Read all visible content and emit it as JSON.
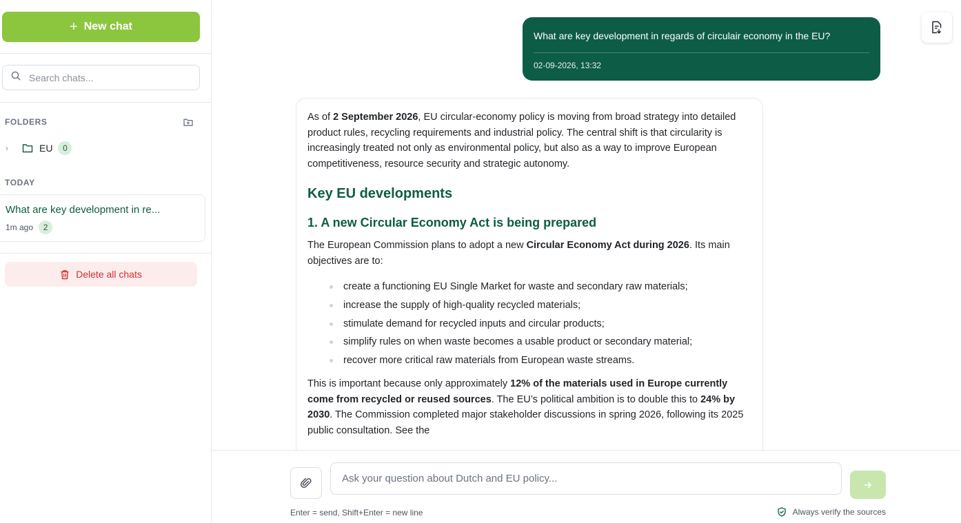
{
  "sidebar": {
    "new_chat_label": "New chat",
    "search_placeholder": "Search chats...",
    "folders_heading": "FOLDERS",
    "folders": [
      {
        "name": "EU",
        "count": "0"
      }
    ],
    "today_heading": "TODAY",
    "chats": [
      {
        "title": "What are key development in re...",
        "time": "1m ago",
        "count": "2"
      }
    ],
    "delete_all_label": "Delete all chats"
  },
  "conversation": {
    "user_message": "What are key development in regards of circulair economy in the EU?",
    "user_timestamp": "02-09-2026, 13:32",
    "answer": {
      "intro_pre": "As of ",
      "intro_bold": "2 September 2026",
      "intro_post": ", EU circular-economy policy is moving from broad strategy into detailed product rules, recycling requirements and industrial policy. The central shift is that circularity is increasingly treated not only as environmental policy, but also as a way to improve European competitiveness, resource security and strategic autonomy.",
      "heading": "Key EU developments",
      "subheading": "1. A new Circular Economy Act is being prepared",
      "p2_pre": "The European Commission plans to adopt a new ",
      "p2_bold": "Circular Economy Act during 2026",
      "p2_post": ". Its main objectives are to:",
      "bullets": [
        "create a functioning EU Single Market for waste and secondary raw materials;",
        "increase the supply of high-quality recycled materials;",
        "stimulate demand for recycled inputs and circular products;",
        "simplify rules on when waste becomes a usable product or secondary material;",
        "recover more critical raw materials from European waste streams."
      ],
      "p3_pre": "This is important because only approximately ",
      "p3_bold1": "12% of the materials used in Europe currently come from recycled or reused sources",
      "p3_mid": ". The EU’s political ambition is to double this to ",
      "p3_bold2": "24% by 2030",
      "p3_post": ". The Commission completed major stakeholder discussions in spring 2026, following its 2025 public consultation. See the"
    }
  },
  "composer": {
    "placeholder": "Ask your question about Dutch and EU policy...",
    "hint": "Enter = send, Shift+Enter = new line",
    "verify_note": "Always verify the sources"
  },
  "colors": {
    "accent_green": "#8cc63f",
    "dark_green": "#0d5c45",
    "danger": "#d0302f"
  }
}
